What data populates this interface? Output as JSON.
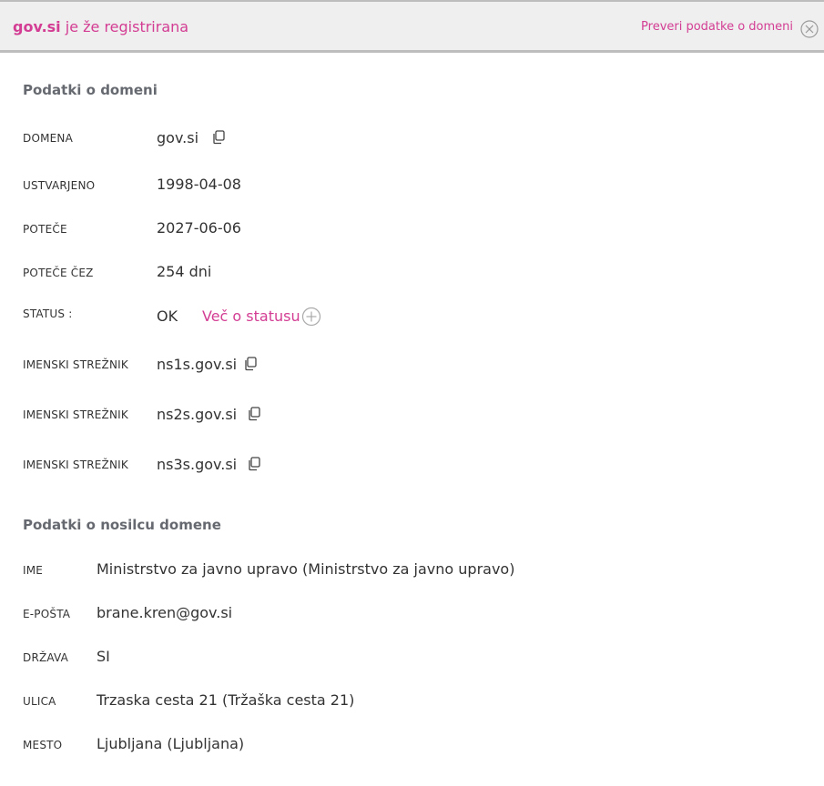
{
  "header": {
    "domain": "gov.si",
    "suffix": " je že registrirana",
    "link_text": "Preveri podatke o domeni"
  },
  "domain_info": {
    "title": "Podatki o domeni",
    "rows": [
      {
        "label": "DOMENA",
        "value": "gov.si"
      },
      {
        "label": "USTVARJENO",
        "value": "1998-04-08"
      },
      {
        "label": "POTEČE",
        "value": "2027-06-06"
      },
      {
        "label": "POTEČE ČEZ",
        "value": "254 dni"
      },
      {
        "label": "STATUS :",
        "value": "OK"
      },
      {
        "label": "IMENSKI STREŽNIK",
        "value": "ns1s.gov.si"
      },
      {
        "label": "IMENSKI STREŽNIK",
        "value": "ns2s.gov.si"
      },
      {
        "label": "IMENSKI STREŽNIK",
        "value": "ns3s.gov.si"
      }
    ],
    "status_link": "Več o statusu"
  },
  "holder_info": {
    "title": "Podatki o nosilcu domene",
    "rows": [
      {
        "label": "IME",
        "value": "Ministrstvo za javno upravo (Ministrstvo za javno upravo)"
      },
      {
        "label": "E-POŠTA",
        "value": "brane.kren@gov.si"
      },
      {
        "label": "DRŽAVA",
        "value": "SI"
      },
      {
        "label": "ULICA",
        "value": "Trzaska cesta 21 (Tržaška cesta 21)"
      },
      {
        "label": "MESTO",
        "value": "Ljubljana (Ljubljana)"
      }
    ]
  },
  "colors": {
    "accent": "#d33d93",
    "header_bg": "#efefef",
    "section_title": "#666a70"
  }
}
